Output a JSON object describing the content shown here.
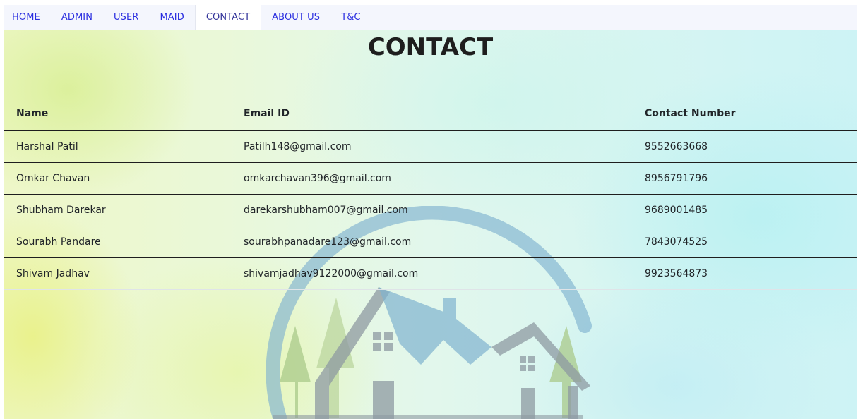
{
  "nav": {
    "items": [
      {
        "label": "HOME"
      },
      {
        "label": "ADMIN"
      },
      {
        "label": "USER"
      },
      {
        "label": "MAID"
      },
      {
        "label": "CONTACT"
      },
      {
        "label": "ABOUT US"
      },
      {
        "label": "T&C"
      }
    ],
    "active": "CONTACT"
  },
  "page": {
    "title": "CONTACT"
  },
  "table": {
    "headers": [
      "Name",
      "Email ID",
      "Contact Number"
    ],
    "rows": [
      [
        "Harshal Patil",
        "Patilh148@gmail.com",
        "9552663668"
      ],
      [
        "Omkar Chavan",
        "omkarchavan396@gmail.com",
        "8956791796"
      ],
      [
        "Shubham Darekar",
        "darekarshubham007@gmail.com",
        "9689001485"
      ],
      [
        "Sourabh Pandare",
        "sourabhpanadare123@gmail.com",
        "7843074525"
      ],
      [
        "Shivam Jadhav",
        "shivamjadhav9122000@gmail.com",
        "9923564873"
      ]
    ]
  },
  "colors": {
    "nav_link": "#2a2ee0",
    "text": "#212529",
    "watermark_blue": "#7fb2cf",
    "watermark_gray": "#8e9aa2",
    "watermark_green": "#a9c98a"
  },
  "watermark": {
    "icon": "house-logo-icon"
  }
}
